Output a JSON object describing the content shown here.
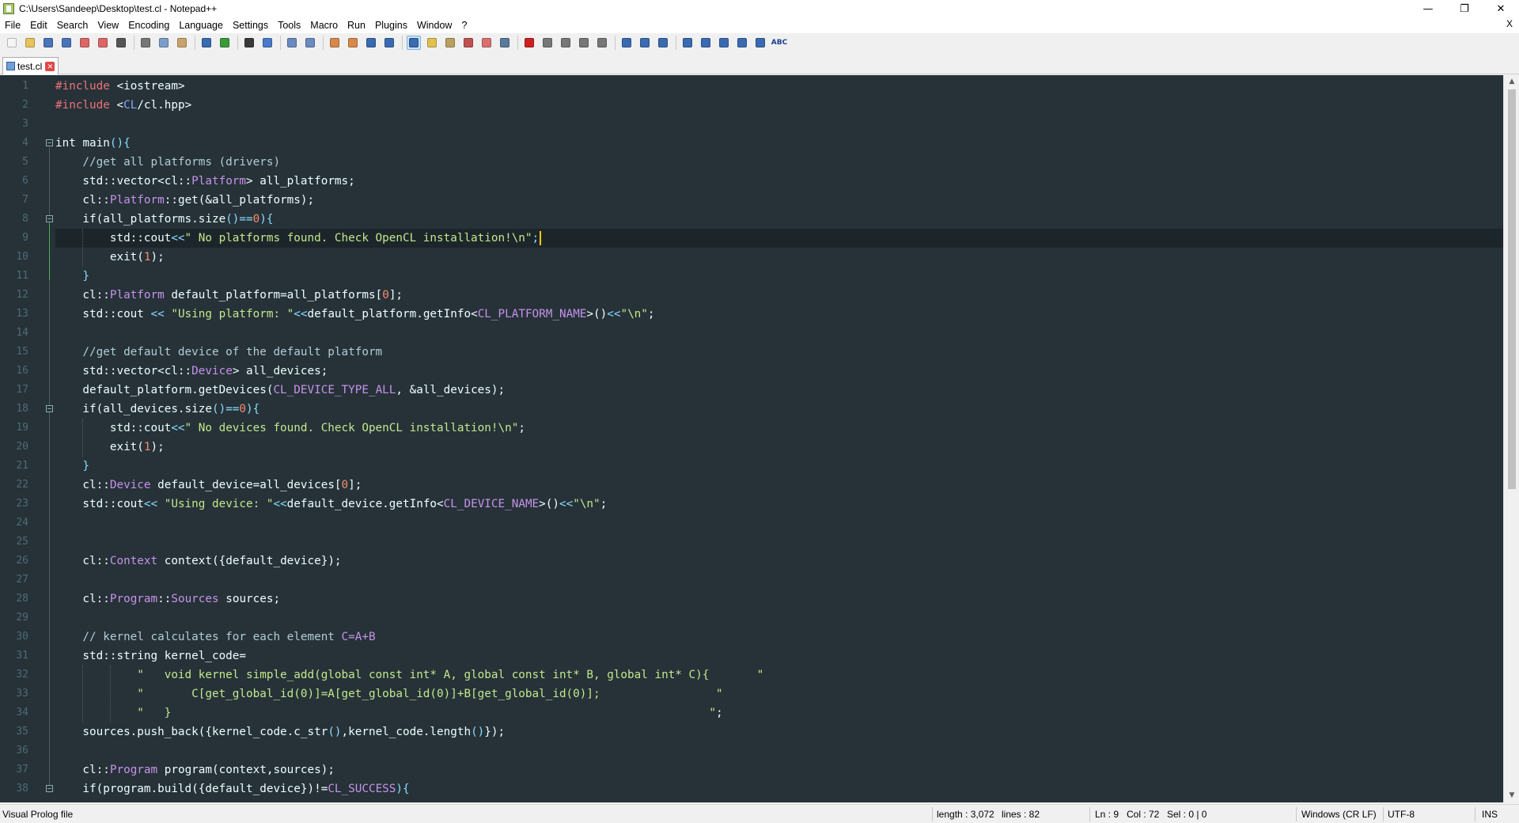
{
  "window": {
    "title": "C:\\Users\\Sandeep\\Desktop\\test.cl - Notepad++",
    "minimize": "—",
    "restore": "❐",
    "close": "✕"
  },
  "menu": {
    "items": [
      "File",
      "Edit",
      "Search",
      "View",
      "Encoding",
      "Language",
      "Settings",
      "Tools",
      "Macro",
      "Run",
      "Plugins",
      "Window",
      "?"
    ],
    "close_doc": "X"
  },
  "toolbar": {
    "buttons": [
      "new-file",
      "open-file",
      "save",
      "save-all",
      "close",
      "close-all",
      "print",
      "cut",
      "copy",
      "paste",
      "undo",
      "redo",
      "find",
      "replace",
      "zoom-in",
      "zoom-out",
      "sync-vertical",
      "sync-horizontal",
      "word-wrap",
      "show-all-characters",
      "indent-guide",
      "user-defined-language",
      "document-map",
      "function-list",
      "folder-as-workspace",
      "monitoring",
      "record-macro",
      "stop-recording",
      "playback-macro",
      "run-macro-multiple",
      "save-macro",
      "open-in-new-instance",
      "clone-view",
      "move-view",
      "fold-all",
      "collapse",
      "expand",
      "unfold-all",
      "compare",
      "spell-check"
    ],
    "spell_label": "ABC"
  },
  "tabs": [
    {
      "label": "test.cl",
      "active": true
    }
  ],
  "editor": {
    "current_line": 9,
    "lines": [
      [
        [
          "#include",
          "pp"
        ],
        [
          " <iostream>",
          "inc"
        ]
      ],
      [
        [
          "#include",
          "pp"
        ],
        [
          " <",
          "inc"
        ],
        [
          "CL",
          "cls"
        ],
        [
          "/cl.hpp>",
          "inc"
        ]
      ],
      [],
      [
        [
          "int ",
          "tx"
        ],
        [
          "main",
          "tx"
        ],
        [
          "()",
          "op"
        ],
        [
          "{",
          "op"
        ]
      ],
      [
        [
          "    //get all platforms (drivers)",
          "cm"
        ]
      ],
      [
        [
          "    std::vector<cl::",
          "tx"
        ],
        [
          "Platform",
          "kw"
        ],
        [
          "> all_platforms;",
          "tx"
        ]
      ],
      [
        [
          "    cl::",
          "tx"
        ],
        [
          "Platform",
          "kw"
        ],
        [
          "::get(&all_platforms);",
          "tx"
        ]
      ],
      [
        [
          "    if(all_platforms.size",
          "tx"
        ],
        [
          "()",
          "op"
        ],
        [
          "==",
          "op"
        ],
        [
          "0",
          "nu"
        ],
        [
          "){",
          "op"
        ]
      ],
      [
        [
          "        std::cout",
          "tx"
        ],
        [
          "<<",
          "op"
        ],
        [
          "\" No platforms found. Check OpenCL installation!\\n\"",
          "st"
        ],
        [
          ";",
          "op"
        ]
      ],
      [
        [
          "        exit(",
          "tx"
        ],
        [
          "1",
          "nu"
        ],
        [
          ");",
          "tx"
        ]
      ],
      [
        [
          "    }",
          "op"
        ]
      ],
      [
        [
          "    cl::",
          "tx"
        ],
        [
          "Platform",
          "kw"
        ],
        [
          " default_platform=all_platforms[",
          "tx"
        ],
        [
          "0",
          "nu"
        ],
        [
          "];",
          "tx"
        ]
      ],
      [
        [
          "    std::cout ",
          "tx"
        ],
        [
          "<<",
          "op"
        ],
        [
          " \"Using platform: \"",
          "st"
        ],
        [
          "<<",
          "op"
        ],
        [
          "default_platform.getInfo<",
          "tx"
        ],
        [
          "CL_PLATFORM_NAME",
          "ty"
        ],
        [
          ">()",
          "tx"
        ],
        [
          "<<",
          "op"
        ],
        [
          "\"\\n\"",
          "st"
        ],
        [
          ";",
          "tx"
        ]
      ],
      [],
      [
        [
          "    //get default device of the default platform",
          "cm"
        ]
      ],
      [
        [
          "    std::vector<cl::",
          "tx"
        ],
        [
          "Device",
          "kw"
        ],
        [
          "> all_devices;",
          "tx"
        ]
      ],
      [
        [
          "    default_platform.getDevices(",
          "tx"
        ],
        [
          "CL_DEVICE_TYPE_ALL",
          "ty"
        ],
        [
          ", &all_devices);",
          "tx"
        ]
      ],
      [
        [
          "    if(all_devices.size",
          "tx"
        ],
        [
          "()",
          "op"
        ],
        [
          "==",
          "op"
        ],
        [
          "0",
          "nu"
        ],
        [
          "){",
          "op"
        ]
      ],
      [
        [
          "        std::cout",
          "tx"
        ],
        [
          "<<",
          "op"
        ],
        [
          "\" No devices found. Check OpenCL installation!\\n\"",
          "st"
        ],
        [
          ";",
          "tx"
        ]
      ],
      [
        [
          "        exit(",
          "tx"
        ],
        [
          "1",
          "nu"
        ],
        [
          ");",
          "tx"
        ]
      ],
      [
        [
          "    }",
          "op"
        ]
      ],
      [
        [
          "    cl::",
          "tx"
        ],
        [
          "Device",
          "kw"
        ],
        [
          " default_device=all_devices[",
          "tx"
        ],
        [
          "0",
          "nu"
        ],
        [
          "];",
          "tx"
        ]
      ],
      [
        [
          "    std::cout",
          "tx"
        ],
        [
          "<<",
          "op"
        ],
        [
          " \"Using device: \"",
          "st"
        ],
        [
          "<<",
          "op"
        ],
        [
          "default_device.getInfo<",
          "tx"
        ],
        [
          "CL_DEVICE_NAME",
          "ty"
        ],
        [
          ">()",
          "tx"
        ],
        [
          "<<",
          "op"
        ],
        [
          "\"\\n\"",
          "st"
        ],
        [
          ";",
          "tx"
        ]
      ],
      [],
      [],
      [
        [
          "    cl::",
          "tx"
        ],
        [
          "Context",
          "kw"
        ],
        [
          " context({default_device});",
          "tx"
        ]
      ],
      [],
      [
        [
          "    cl::",
          "tx"
        ],
        [
          "Program",
          "kw"
        ],
        [
          "::",
          "tx"
        ],
        [
          "Sources",
          "kw"
        ],
        [
          " sources;",
          "tx"
        ]
      ],
      [],
      [
        [
          "    // kernel calculates for each element ",
          "cm"
        ],
        [
          "C=A+B",
          "kw"
        ]
      ],
      [
        [
          "    std::string kernel_code=",
          "tx"
        ]
      ],
      [
        [
          "            \"   void kernel simple_add(global const int* A, global const int* B, global int* C){       \"",
          "st"
        ]
      ],
      [
        [
          "            \"       C[get_global_id(0)]=A[get_global_id(0)]+B[get_global_id(0)];                 \"",
          "st"
        ]
      ],
      [
        [
          "            \"   }                                                                               \"",
          "st"
        ],
        [
          ";",
          "tx"
        ]
      ],
      [
        [
          "    sources.push_back({kernel_code.c_str",
          "tx"
        ],
        [
          "()",
          "op"
        ],
        [
          ",kernel_code.length",
          "tx"
        ],
        [
          "()",
          "op"
        ],
        [
          "});",
          "tx"
        ]
      ],
      [],
      [
        [
          "    cl::",
          "tx"
        ],
        [
          "Program",
          "kw"
        ],
        [
          " program(context,sources);",
          "tx"
        ]
      ],
      [
        [
          "    if(program.build({default_device})!=",
          "tx"
        ],
        [
          "CL_SUCCESS",
          "ty"
        ],
        [
          "){",
          "op"
        ]
      ]
    ]
  },
  "status": {
    "file_type": "Visual Prolog file",
    "length": "length : 3,072",
    "lines": "lines : 82",
    "ln": "Ln : 9",
    "col": "Col : 72",
    "sel": "Sel : 0 | 0",
    "eol": "Windows (CR LF)",
    "encoding": "UTF-8",
    "mode": "INS"
  }
}
